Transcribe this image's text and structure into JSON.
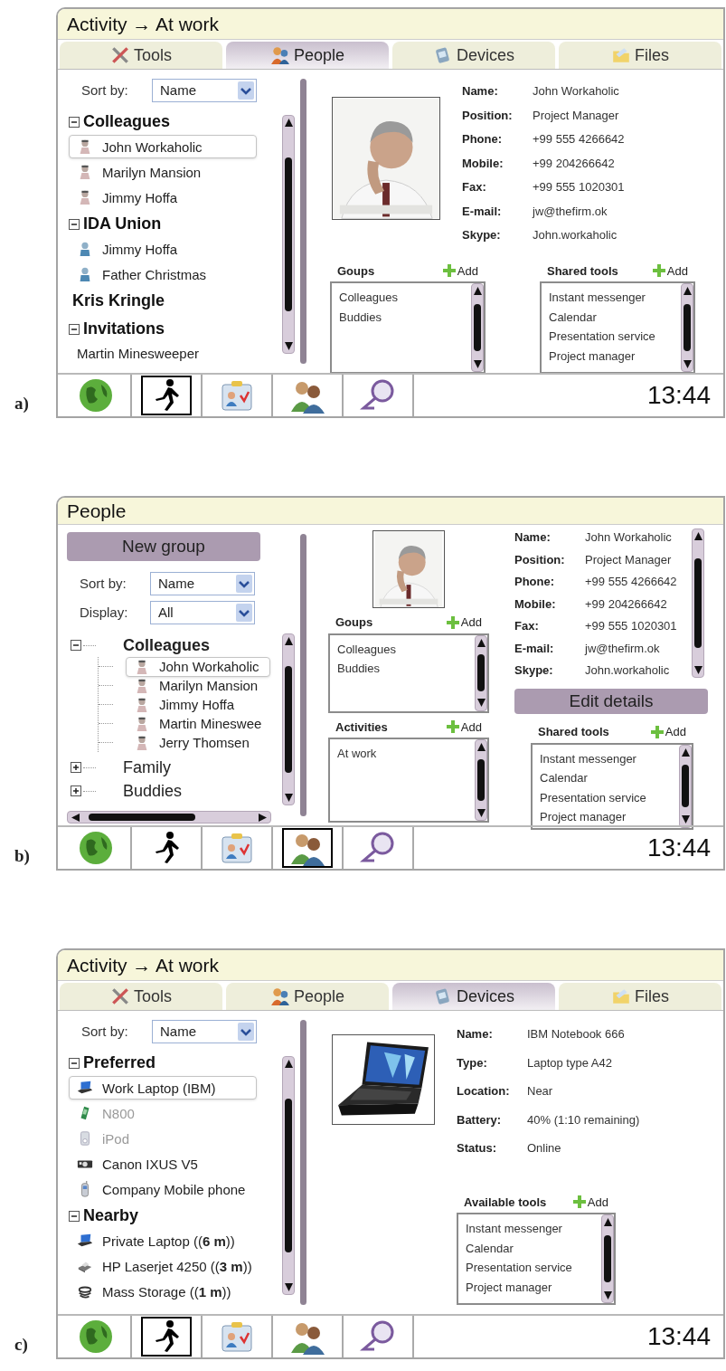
{
  "panels": [
    {
      "kind": "tabbed_people",
      "caption": "a)",
      "title": "Activity → At work",
      "tabs": [
        {
          "label": "Tools",
          "kind": "tools",
          "selected": false
        },
        {
          "label": "People",
          "kind": "people",
          "selected": true
        },
        {
          "label": "Devices",
          "kind": "devices",
          "selected": false
        },
        {
          "label": "Files",
          "kind": "files",
          "selected": false
        }
      ],
      "filters": [
        {
          "label": "Sort by:",
          "value": "Name"
        }
      ],
      "tree": [
        {
          "label": "Colleagues",
          "kind": "group",
          "expanded": true,
          "children": [
            {
              "label": "John Workaholic",
              "kind": "contact",
              "selected": true
            },
            {
              "label": "Marilyn Mansion",
              "kind": "contact",
              "selected": false
            },
            {
              "label": "Jimmy Hoffa",
              "kind": "contact",
              "selected": false
            }
          ]
        },
        {
          "label": "IDA Union",
          "kind": "group",
          "expanded": true,
          "children": [
            {
              "label": "Jimmy Hoffa",
              "kind": "member",
              "selected": false
            },
            {
              "label": "Father Christmas",
              "kind": "member",
              "selected": false
            }
          ]
        },
        {
          "label": "Kris Kringle",
          "kind": "entry"
        },
        {
          "label": "Invitations",
          "kind": "group",
          "expanded": true,
          "children": [
            {
              "label": "Martin Minesweeper",
              "kind": "invite",
              "selected": false
            }
          ]
        }
      ],
      "details": [
        {
          "label": "Name:",
          "value": "John Workaholic"
        },
        {
          "label": "Position:",
          "value": "Project Manager"
        },
        {
          "label": "Phone:",
          "value": "+99 555 4266642"
        },
        {
          "label": "Mobile:",
          "value": "+99 204266642"
        },
        {
          "label": "Fax:",
          "value": "+99 555 1020301"
        },
        {
          "label": "E-mail:",
          "value": "jw@thefirm.ok"
        },
        {
          "label": "Skype:",
          "value": "John.workaholic"
        }
      ],
      "lists": [
        {
          "title": "Goups",
          "add": "Add",
          "items": [
            "Colleagues",
            "Buddies"
          ]
        },
        {
          "title": "Shared tools",
          "add": "Add",
          "items": [
            "Instant messenger",
            "Calendar",
            "Presentation service",
            "Project manager"
          ]
        }
      ],
      "taskbar": [
        {
          "kind": "globe",
          "selected": false
        },
        {
          "kind": "runner",
          "selected": true
        },
        {
          "kind": "card",
          "selected": false
        },
        {
          "kind": "people",
          "selected": false
        },
        {
          "kind": "search",
          "selected": false
        }
      ],
      "clock": "13:44"
    },
    {
      "kind": "people_manager",
      "caption": "b)",
      "title": "People",
      "new_group": "New group",
      "edit": "Edit details",
      "filters": [
        {
          "label": "Sort by:",
          "value": "Name"
        },
        {
          "label": "Display:",
          "value": "All"
        }
      ],
      "tree": [
        {
          "label": "Colleagues",
          "kind": "group",
          "expanded": true,
          "children": [
            {
              "label": "John Workaholic",
              "kind": "contact",
              "selected": true
            },
            {
              "label": "Marilyn Mansion",
              "kind": "contact",
              "selected": false
            },
            {
              "label": "Jimmy Hoffa",
              "kind": "contact",
              "selected": false
            },
            {
              "label": "Martin Mineswee",
              "kind": "contact",
              "selected": false
            },
            {
              "label": "Jerry Thomsen",
              "kind": "contact",
              "selected": false
            }
          ]
        },
        {
          "label": "Family",
          "kind": "group",
          "expanded": false
        },
        {
          "label": "Buddies",
          "kind": "group",
          "expanded": false
        }
      ],
      "details": [
        {
          "label": "Name:",
          "value": "John Workaholic"
        },
        {
          "label": "Position:",
          "value": "Project Manager"
        },
        {
          "label": "Phone:",
          "value": "+99 555 4266642"
        },
        {
          "label": "Mobile:",
          "value": "+99 204266642"
        },
        {
          "label": "Fax:",
          "value": "+99 555 1020301"
        },
        {
          "label": "E-mail:",
          "value": "jw@thefirm.ok"
        },
        {
          "label": "Skype:",
          "value": "John.workaholic"
        }
      ],
      "lists": [
        {
          "title": "Goups",
          "add": "Add",
          "items": [
            "Colleagues",
            "Buddies"
          ]
        },
        {
          "title": "Activities",
          "add": "Add",
          "items": [
            "At work"
          ]
        },
        {
          "title": "Shared tools",
          "add": "Add",
          "items": [
            "Instant messenger",
            "Calendar",
            "Presentation service",
            "Project manager"
          ]
        }
      ],
      "taskbar": [
        {
          "kind": "globe",
          "selected": false
        },
        {
          "kind": "runner",
          "selected": false
        },
        {
          "kind": "card",
          "selected": false
        },
        {
          "kind": "people",
          "selected": true
        },
        {
          "kind": "search",
          "selected": false
        }
      ],
      "clock": "13:44"
    },
    {
      "kind": "tabbed_devices",
      "caption": "c)",
      "title": "Activity → At work",
      "tabs": [
        {
          "label": "Tools",
          "kind": "tools",
          "selected": false
        },
        {
          "label": "People",
          "kind": "people",
          "selected": false
        },
        {
          "label": "Devices",
          "kind": "devices",
          "selected": true
        },
        {
          "label": "Files",
          "kind": "files",
          "selected": false
        }
      ],
      "filters": [
        {
          "label": "Sort by:",
          "value": "Name"
        }
      ],
      "tree": [
        {
          "label": "Preferred",
          "kind": "group",
          "expanded": true,
          "children": [
            {
              "label": "Work Laptop (IBM)",
              "kind": "laptop",
              "selected": true,
              "disabled": false
            },
            {
              "label": "N800",
              "kind": "pda",
              "selected": false,
              "disabled": true
            },
            {
              "label": "iPod",
              "kind": "player",
              "selected": false,
              "disabled": true
            },
            {
              "label": "Canon IXUS V5",
              "kind": "camera",
              "selected": false,
              "disabled": false
            },
            {
              "label": "Company Mobile phone",
              "kind": "phone",
              "selected": false,
              "disabled": false
            }
          ]
        },
        {
          "label": "Nearby",
          "kind": "group",
          "expanded": true,
          "children": [
            {
              "label": "Private Laptop ((**6 m**))",
              "kind": "laptop",
              "selected": false,
              "disabled": false
            },
            {
              "label": "HP Laserjet 4250 ((**3 m**))",
              "kind": "printer",
              "selected": false,
              "disabled": false
            },
            {
              "label": "Mass Storage ((**1 m**))",
              "kind": "storage",
              "selected": false,
              "disabled": false
            }
          ]
        }
      ],
      "details": [
        {
          "label": "Name:",
          "value": "IBM Notebook 666"
        },
        {
          "label": "Type:",
          "value": "Laptop type A42"
        },
        {
          "label": "Location:",
          "value": "Near"
        },
        {
          "label": "Battery:",
          "value": "40% (1:10 remaining)"
        },
        {
          "label": "Status:",
          "value": "Online"
        }
      ],
      "lists": [
        {
          "title": "Available tools",
          "add": "Add",
          "items": [
            "Instant messenger",
            "Calendar",
            "Presentation service",
            "Project manager"
          ]
        }
      ],
      "taskbar": [
        {
          "kind": "globe",
          "selected": false
        },
        {
          "kind": "runner",
          "selected": true
        },
        {
          "kind": "card",
          "selected": false
        },
        {
          "kind": "people",
          "selected": false
        },
        {
          "kind": "search",
          "selected": false
        }
      ],
      "clock": "13:44"
    }
  ]
}
